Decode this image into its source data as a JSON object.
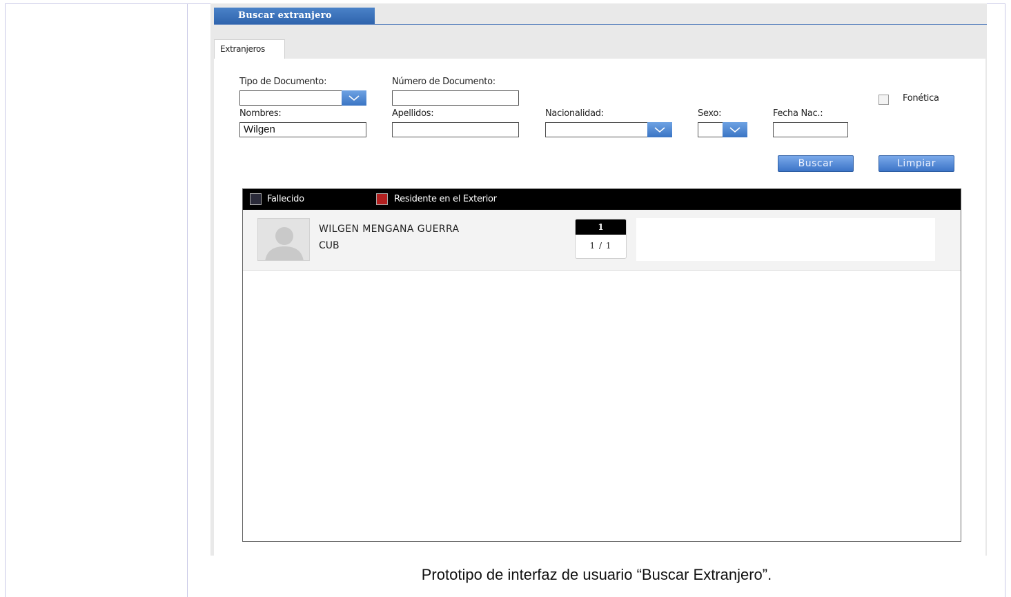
{
  "window": {
    "title": "Buscar extranjero"
  },
  "tabs": [
    {
      "label": "Extranjeros"
    }
  ],
  "form": {
    "tipo_documento": {
      "label": "Tipo de Documento:",
      "value": ""
    },
    "numero_documento": {
      "label": "Número de Documento:",
      "value": ""
    },
    "fonetica": {
      "label": "Fonética",
      "checked": false
    },
    "nombres": {
      "label": "Nombres:",
      "value": "Wilgen"
    },
    "apellidos": {
      "label": "Apellidos:",
      "value": ""
    },
    "nacionalidad": {
      "label": "Nacionalidad:",
      "value": ""
    },
    "sexo": {
      "label": "Sexo:",
      "value": ""
    },
    "fecha_nac": {
      "label": "Fecha Nac.:",
      "value": ""
    }
  },
  "buttons": {
    "buscar": "Buscar",
    "limpiar": "Limpiar"
  },
  "legend": [
    {
      "label": "Fallecido",
      "color": "#2b2b3a"
    },
    {
      "label": "Residente en el Exterior",
      "color": "#b22020"
    }
  ],
  "results": [
    {
      "name": "WILGEN MENGANA GUERRA",
      "nationality": "CUB"
    }
  ],
  "pager": {
    "current": "1",
    "summary": "1 / 1"
  },
  "caption": "Prototipo de interfaz de usuario “Buscar Extranjero”.",
  "colors": {
    "accent": "#3c74c7",
    "header_bar": "#000000"
  }
}
